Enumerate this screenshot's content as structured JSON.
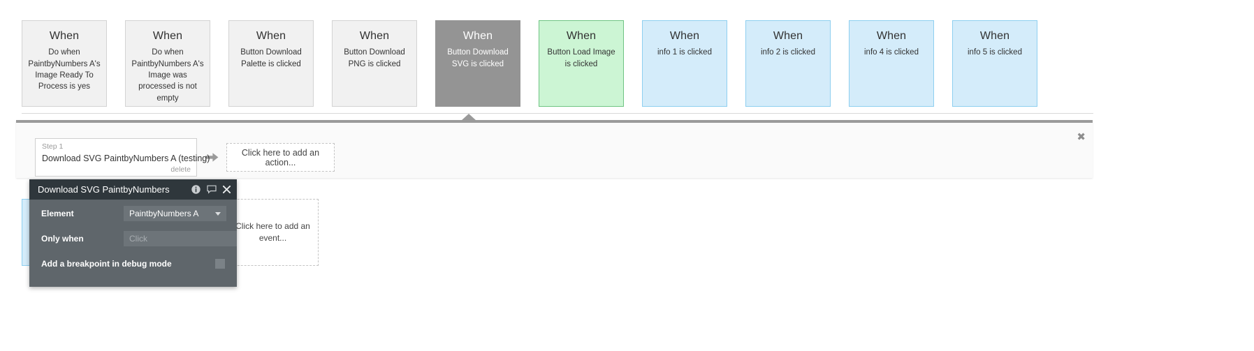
{
  "events": [
    {
      "when": "When",
      "desc": "Do when PaintbyNumbers A's Image Ready To Process is yes",
      "style": "default"
    },
    {
      "when": "When",
      "desc": "Do when PaintbyNumbers A's Image was processed is not empty",
      "style": "default"
    },
    {
      "when": "When",
      "desc": "Button Download Palette is clicked",
      "style": "default"
    },
    {
      "when": "When",
      "desc": "Button Download PNG is clicked",
      "style": "default"
    },
    {
      "when": "When",
      "desc": "Button Download SVG is clicked",
      "style": "selected"
    },
    {
      "when": "When",
      "desc": "Button Load Image is clicked",
      "style": "green"
    },
    {
      "when": "When",
      "desc": "info 1 is clicked",
      "style": "blue"
    },
    {
      "when": "When",
      "desc": "info 2 is clicked",
      "style": "blue"
    },
    {
      "when": "When",
      "desc": "info 4 is clicked",
      "style": "blue"
    },
    {
      "when": "When",
      "desc": "info 5 is clicked",
      "style": "blue"
    }
  ],
  "workflow": {
    "close_label": "✖",
    "step": {
      "label": "Step 1",
      "title": "Download SVG PaintbyNumbers A (testing)",
      "delete_label": "delete"
    },
    "arrow_glyph": "➜",
    "add_action_label": "Click here to add an action...",
    "add_event_label": "Click here to add an event..."
  },
  "properties": {
    "title": "Download SVG PaintbyNumbers",
    "info_icon": "info-icon",
    "comment_icon": "comment-icon",
    "close_icon": "close-icon",
    "close_glyph": "✖",
    "element": {
      "label": "Element",
      "value": "PaintbyNumbers A"
    },
    "only_when": {
      "label": "Only when",
      "placeholder": "Click",
      "value": ""
    },
    "breakpoint": {
      "label": "Add a breakpoint in debug mode",
      "checked": false
    }
  },
  "colors": {
    "selected_card": "#949494",
    "green_card": "#ccf5d4",
    "blue_card": "#d4ecfa",
    "panel_dark": "#2f373c",
    "panel_body": "#5f666b"
  }
}
